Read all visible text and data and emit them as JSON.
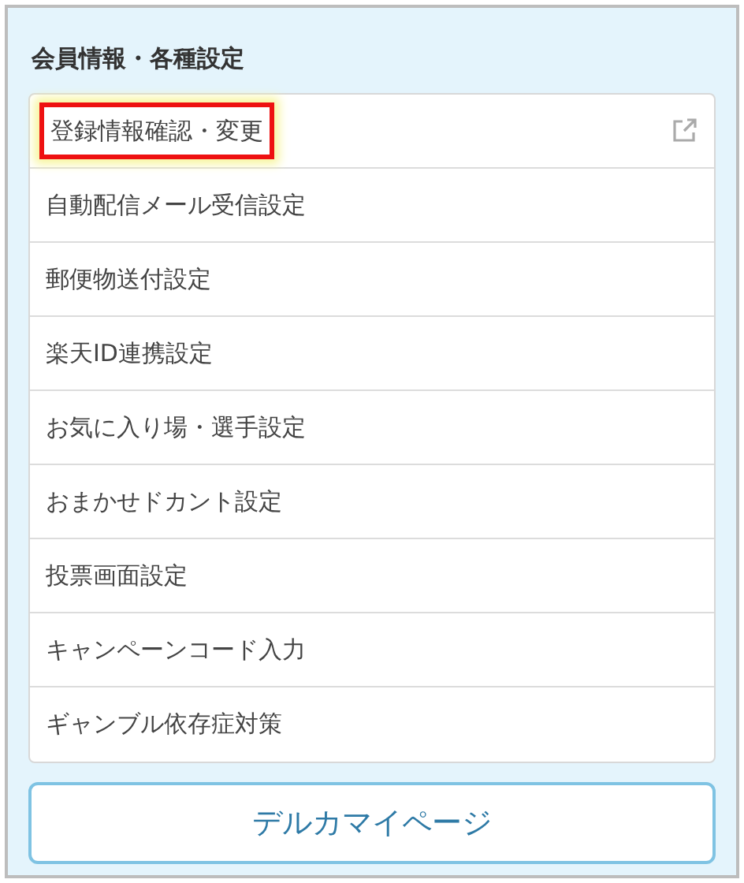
{
  "section": {
    "title": "会員情報・各種設定"
  },
  "items": [
    {
      "label": "登録情報確認・変更",
      "highlighted": true,
      "external": true
    },
    {
      "label": "自動配信メール受信設定",
      "highlighted": false,
      "external": false
    },
    {
      "label": "郵便物送付設定",
      "highlighted": false,
      "external": false
    },
    {
      "label": "楽天ID連携設定",
      "highlighted": false,
      "external": false
    },
    {
      "label": "お気に入り場・選手設定",
      "highlighted": false,
      "external": false
    },
    {
      "label": "おまかせドカント設定",
      "highlighted": false,
      "external": false
    },
    {
      "label": "投票画面設定",
      "highlighted": false,
      "external": false
    },
    {
      "label": "キャンペーンコード入力",
      "highlighted": false,
      "external": false
    },
    {
      "label": "ギャンブル依存症対策",
      "highlighted": false,
      "external": false
    }
  ],
  "button": {
    "label": "デルカマイページ"
  }
}
